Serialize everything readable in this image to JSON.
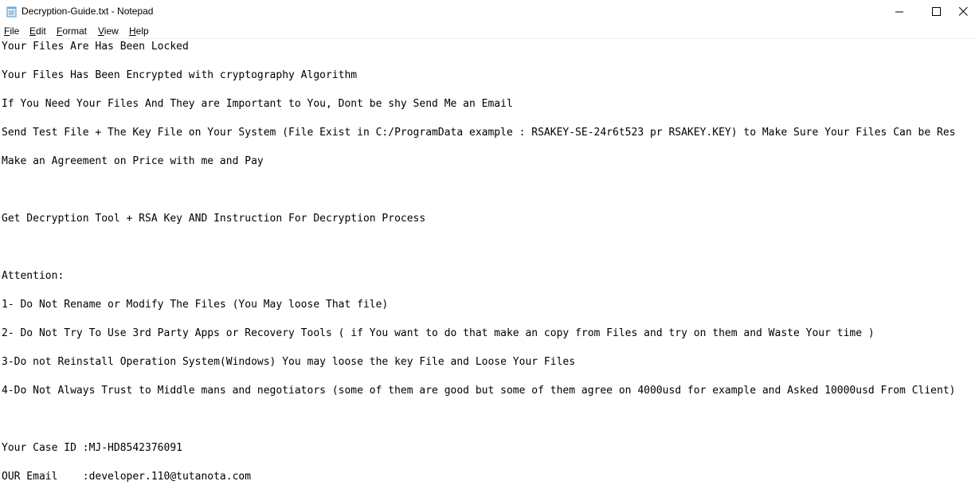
{
  "window": {
    "title": "Decryption-Guide.txt - Notepad",
    "icon": "notepad-icon",
    "controls": [
      "minimize-icon",
      "maximize-icon",
      "close-icon"
    ]
  },
  "menu": {
    "file": {
      "accel": "F",
      "rest": "ile"
    },
    "edit": {
      "accel": "E",
      "rest": "dit"
    },
    "format": {
      "accel": "F",
      "pre": "",
      "rest": "ormat"
    },
    "view": {
      "accel": "V",
      "rest": "iew"
    },
    "help": {
      "accel": "H",
      "rest": "elp"
    }
  },
  "document": {
    "lines": [
      "Your Files Are Has Been Locked",
      "",
      "Your Files Has Been Encrypted with cryptography Algorithm",
      "",
      "If You Need Your Files And They are Important to You, Dont be shy Send Me an Email",
      "",
      "Send Test File + The Key File on Your System (File Exist in C:/ProgramData example : RSAKEY-SE-24r6t523 pr RSAKEY.KEY) to Make Sure Your Files Can be Res",
      "",
      "Make an Agreement on Price with me and Pay",
      "",
      "",
      "",
      "Get Decryption Tool + RSA Key AND Instruction For Decryption Process",
      "",
      "",
      "",
      "Attention:",
      "",
      "1- Do Not Rename or Modify The Files (You May loose That file)",
      "",
      "2- Do Not Try To Use 3rd Party Apps or Recovery Tools ( if You want to do that make an copy from Files and try on them and Waste Your time )",
      "",
      "3-Do not Reinstall Operation System(Windows) You may loose the key File and Loose Your Files",
      "",
      "4-Do Not Always Trust to Middle mans and negotiators (some of them are good but some of them agree on 4000usd for example and Asked 10000usd From Client)",
      "",
      "",
      "",
      "Your Case ID :MJ-HD8542376091",
      "",
      "OUR Email    :developer.110@tutanota.com"
    ]
  }
}
